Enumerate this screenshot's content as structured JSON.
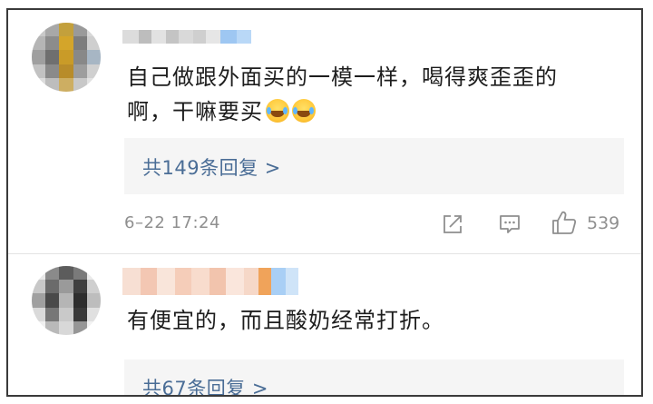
{
  "comments": [
    {
      "text_line1": "自己做跟外面买的一模一样，喝得爽歪歪的",
      "text_line2": "啊，干嘛要买",
      "emojis": [
        "laugh-cry-emoji",
        "laugh-cry-emoji"
      ],
      "replies_label": "共149条回复 >",
      "timestamp": "6–22 17:24",
      "like_count": "539"
    },
    {
      "text_line1": "有便宜的，而且酸奶经常打折。",
      "replies_label": "共67条回复 >"
    }
  ],
  "icons": {
    "share": "share-icon",
    "comment": "comment-icon",
    "like": "thumbs-up-icon"
  },
  "colors": {
    "link": "#4a6d96",
    "meta": "#8f8f8f",
    "reply_bg": "#f5f5f5",
    "text": "#1d1d1d"
  }
}
